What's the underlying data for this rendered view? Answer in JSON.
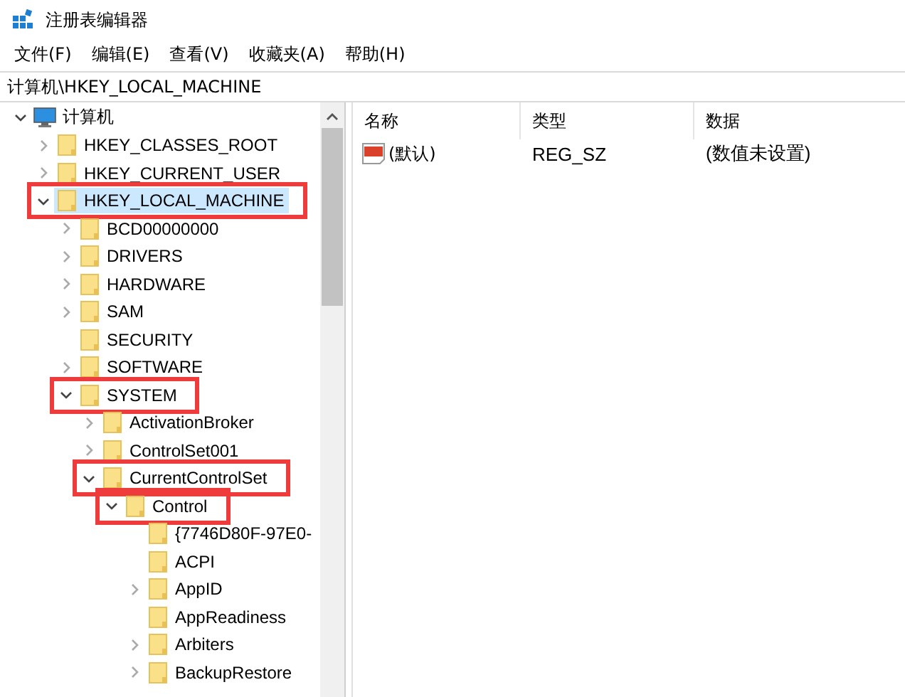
{
  "window": {
    "title": "注册表编辑器"
  },
  "menu": [
    "文件(F)",
    "编辑(E)",
    "查看(V)",
    "收藏夹(A)",
    "帮助(H)"
  ],
  "address": "计算机\\HKEY_LOCAL_MACHINE",
  "tree": [
    {
      "label": "计算机",
      "kind": "computer",
      "expandable": true,
      "expanded": true,
      "selected": false,
      "highlighted": false,
      "children": [
        {
          "label": "HKEY_CLASSES_ROOT",
          "kind": "folder",
          "expandable": true,
          "expanded": false,
          "selected": false,
          "highlighted": false
        },
        {
          "label": "HKEY_CURRENT_USER",
          "kind": "folder",
          "expandable": true,
          "expanded": false,
          "selected": false,
          "highlighted": false
        },
        {
          "label": "HKEY_LOCAL_MACHINE",
          "kind": "folder",
          "expandable": true,
          "expanded": true,
          "selected": true,
          "highlighted": true,
          "children": [
            {
              "label": "BCD00000000",
              "kind": "folder",
              "expandable": true,
              "expanded": false,
              "selected": false,
              "highlighted": false
            },
            {
              "label": "DRIVERS",
              "kind": "folder",
              "expandable": true,
              "expanded": false,
              "selected": false,
              "highlighted": false
            },
            {
              "label": "HARDWARE",
              "kind": "folder",
              "expandable": true,
              "expanded": false,
              "selected": false,
              "highlighted": false
            },
            {
              "label": "SAM",
              "kind": "folder",
              "expandable": true,
              "expanded": false,
              "selected": false,
              "highlighted": false
            },
            {
              "label": "SECURITY",
              "kind": "folder",
              "expandable": false,
              "expanded": false,
              "selected": false,
              "highlighted": false
            },
            {
              "label": "SOFTWARE",
              "kind": "folder",
              "expandable": true,
              "expanded": false,
              "selected": false,
              "highlighted": false
            },
            {
              "label": "SYSTEM",
              "kind": "folder",
              "expandable": true,
              "expanded": true,
              "selected": false,
              "highlighted": true,
              "children": [
                {
                  "label": "ActivationBroker",
                  "kind": "folder",
                  "expandable": true,
                  "expanded": false,
                  "selected": false,
                  "highlighted": false
                },
                {
                  "label": "ControlSet001",
                  "kind": "folder",
                  "expandable": true,
                  "expanded": false,
                  "selected": false,
                  "highlighted": false
                },
                {
                  "label": "CurrentControlSet",
                  "kind": "folder",
                  "expandable": true,
                  "expanded": true,
                  "selected": false,
                  "highlighted": true,
                  "children": [
                    {
                      "label": "Control",
                      "kind": "folder",
                      "expandable": true,
                      "expanded": true,
                      "selected": false,
                      "highlighted": true,
                      "children": [
                        {
                          "label": "{7746D80F-97E0-",
                          "kind": "folder",
                          "expandable": false,
                          "expanded": false,
                          "selected": false,
                          "highlighted": false
                        },
                        {
                          "label": "ACPI",
                          "kind": "folder",
                          "expandable": false,
                          "expanded": false,
                          "selected": false,
                          "highlighted": false
                        },
                        {
                          "label": "AppID",
                          "kind": "folder",
                          "expandable": true,
                          "expanded": false,
                          "selected": false,
                          "highlighted": false
                        },
                        {
                          "label": "AppReadiness",
                          "kind": "folder",
                          "expandable": false,
                          "expanded": false,
                          "selected": false,
                          "highlighted": false
                        },
                        {
                          "label": "Arbiters",
                          "kind": "folder",
                          "expandable": true,
                          "expanded": false,
                          "selected": false,
                          "highlighted": false
                        },
                        {
                          "label": "BackupRestore",
                          "kind": "folder",
                          "expandable": true,
                          "expanded": false,
                          "selected": false,
                          "highlighted": false
                        }
                      ]
                    }
                  ]
                }
              ]
            }
          ]
        }
      ]
    }
  ],
  "columns": [
    "名称",
    "类型",
    "数据"
  ],
  "values": [
    {
      "name": "(默认)",
      "type": "REG_SZ",
      "data": "(数值未设置)"
    }
  ]
}
